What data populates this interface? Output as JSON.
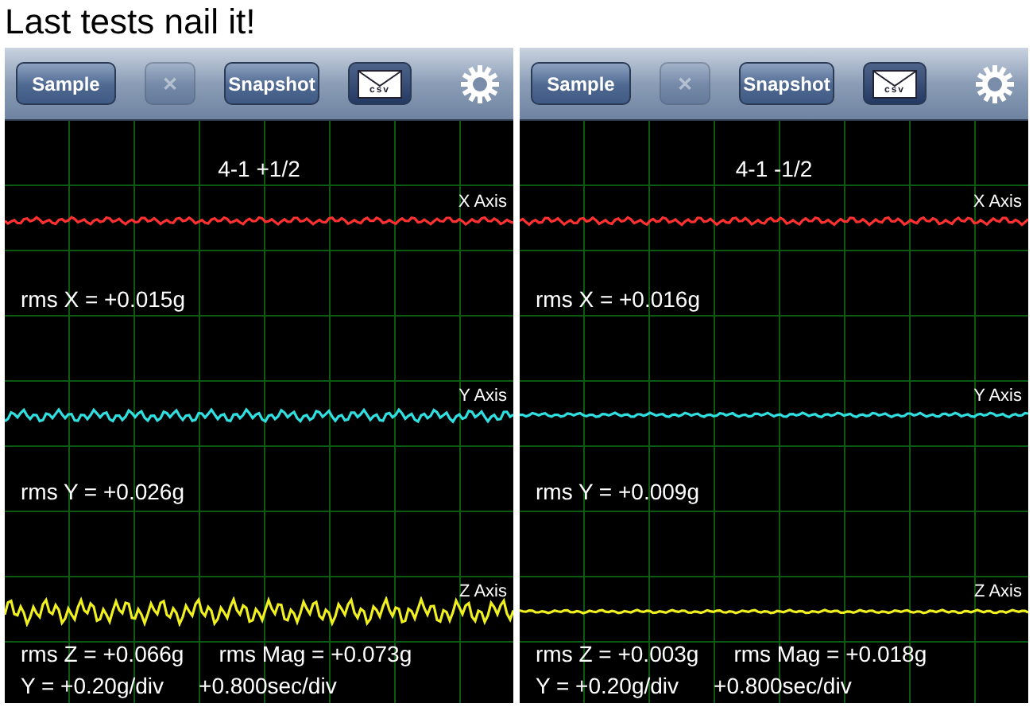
{
  "heading": "Last tests nail it!",
  "panels": [
    {
      "toolbar": [
        {
          "kind": "text",
          "label": "Sample",
          "disabled": false
        },
        {
          "kind": "text",
          "label": "✕",
          "disabled": true
        },
        {
          "kind": "text",
          "label": "Snapshot",
          "disabled": false
        },
        {
          "kind": "mail",
          "label": "csv",
          "disabled": false
        },
        {
          "kind": "settings",
          "disabled": false
        }
      ],
      "plot": {
        "title": "4-1 +1/2",
        "traces": [
          {
            "axis_label": "X Axis",
            "color": "#ff3030",
            "rms": "rms X = +0.015g"
          },
          {
            "axis_label": "Y Axis",
            "color": "#30e0e0",
            "rms": "rms Y = +0.026g"
          },
          {
            "axis_label": "Z Axis",
            "color": "#f0f020",
            "rms": "rms Z = +0.066g"
          }
        ],
        "rms_mag": "rms Mag = +0.073g",
        "y_scale": "Y = +0.20g/div",
        "time_scale": "+0.800sec/div"
      }
    },
    {
      "toolbar": [
        {
          "kind": "text",
          "label": "Sample",
          "disabled": false
        },
        {
          "kind": "text",
          "label": "✕",
          "disabled": true
        },
        {
          "kind": "text",
          "label": "Snapshot",
          "disabled": false
        },
        {
          "kind": "mail",
          "label": "csv",
          "disabled": false
        },
        {
          "kind": "settings",
          "disabled": false
        }
      ],
      "plot": {
        "title": "4-1 -1/2",
        "traces": [
          {
            "axis_label": "X Axis",
            "color": "#ff3030",
            "rms": "rms X = +0.016g"
          },
          {
            "axis_label": "Y Axis",
            "color": "#30e0e0",
            "rms": "rms Y = +0.009g"
          },
          {
            "axis_label": "Z Axis",
            "color": "#f0f020",
            "rms": "rms Z = +0.003g"
          }
        ],
        "rms_mag": "rms Mag = +0.018g",
        "y_scale": "Y = +0.20g/div",
        "time_scale": "+0.800sec/div"
      }
    }
  ]
}
